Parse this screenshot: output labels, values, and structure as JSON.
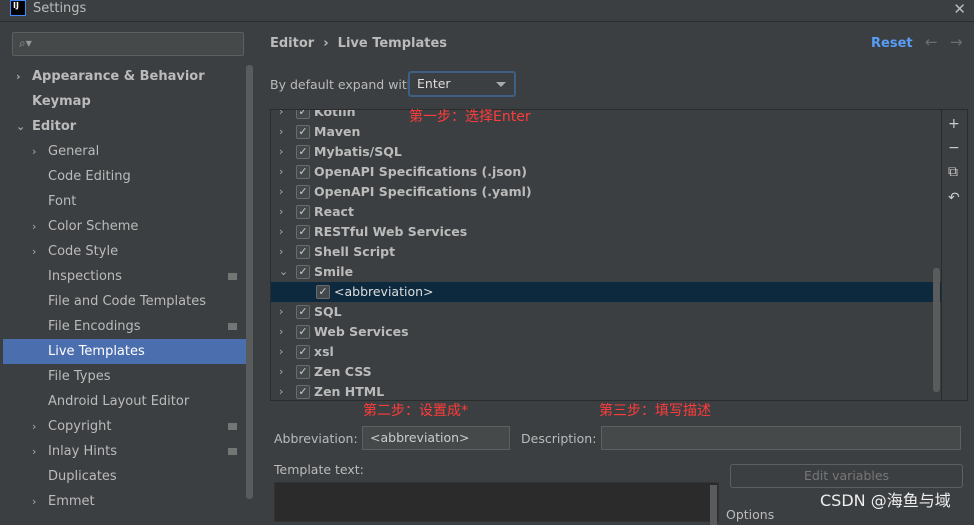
{
  "window": {
    "title": "Settings",
    "logo": "IJ"
  },
  "sidebar": {
    "search_placeholder": "",
    "items": [
      {
        "label": "Appearance & Behavior",
        "bold": true,
        "chevron": "right",
        "level": 0
      },
      {
        "label": "Keymap",
        "bold": true,
        "level": 0
      },
      {
        "label": "Editor",
        "bold": true,
        "chevron": "down",
        "level": 0
      },
      {
        "label": "General",
        "chevron": "right",
        "level": 1
      },
      {
        "label": "Code Editing",
        "level": 1
      },
      {
        "label": "Font",
        "level": 1
      },
      {
        "label": "Color Scheme",
        "chevron": "right",
        "level": 1
      },
      {
        "label": "Code Style",
        "chevron": "right",
        "level": 1
      },
      {
        "label": "Inspections",
        "level": 1,
        "badge": true
      },
      {
        "label": "File and Code Templates",
        "level": 1
      },
      {
        "label": "File Encodings",
        "level": 1,
        "badge": true
      },
      {
        "label": "Live Templates",
        "level": 1,
        "selected": true
      },
      {
        "label": "File Types",
        "level": 1
      },
      {
        "label": "Android Layout Editor",
        "level": 1
      },
      {
        "label": "Copyright",
        "chevron": "right",
        "level": 1,
        "badge": true
      },
      {
        "label": "Inlay Hints",
        "chevron": "right",
        "level": 1,
        "badge": true
      },
      {
        "label": "Duplicates",
        "level": 1
      },
      {
        "label": "Emmet",
        "chevron": "right",
        "level": 1
      }
    ]
  },
  "header": {
    "breadcrumb": [
      "Editor",
      "Live Templates"
    ],
    "reset": "Reset"
  },
  "expand": {
    "label": "By default expand with",
    "value": "Enter"
  },
  "tree": [
    {
      "label": "Kotlin",
      "chevron": "right"
    },
    {
      "label": "Maven",
      "chevron": "right"
    },
    {
      "label": "Mybatis/SQL",
      "chevron": "right"
    },
    {
      "label": "OpenAPI Specifications (.json)",
      "chevron": "right"
    },
    {
      "label": "OpenAPI Specifications (.yaml)",
      "chevron": "right"
    },
    {
      "label": "React",
      "chevron": "right"
    },
    {
      "label": "RESTful Web Services",
      "chevron": "right"
    },
    {
      "label": "Shell Script",
      "chevron": "right"
    },
    {
      "label": "Smile",
      "chevron": "down"
    },
    {
      "label": "<abbreviation>",
      "child": true,
      "selected": true
    },
    {
      "label": "SQL",
      "chevron": "right"
    },
    {
      "label": "Web Services",
      "chevron": "right"
    },
    {
      "label": "xsl",
      "chevron": "right"
    },
    {
      "label": "Zen CSS",
      "chevron": "right"
    },
    {
      "label": "Zen HTML",
      "chevron": "right"
    }
  ],
  "annotations": {
    "step1": "第一步：选择Enter",
    "step2": "第二步：设置成*",
    "step3": "第三步：填写描述"
  },
  "form": {
    "abbr_label": "Abbreviation:",
    "abbr_value": "<abbreviation>",
    "desc_label": "Description:",
    "desc_value": "",
    "template_label": "Template text:",
    "edit_vars": "Edit variables",
    "options": "Options"
  },
  "watermark": "CSDN @海鱼与域"
}
